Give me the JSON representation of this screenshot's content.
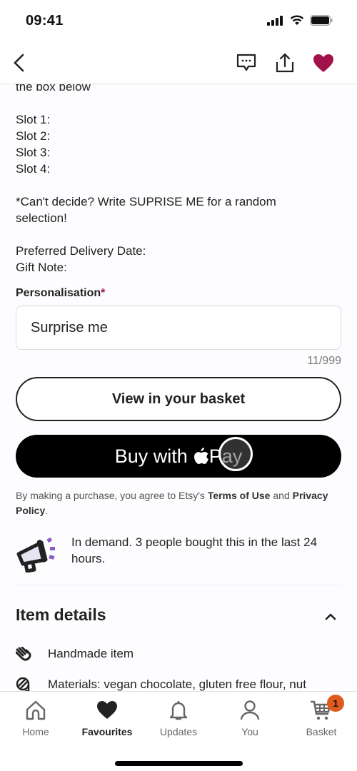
{
  "status_bar": {
    "time": "09:41"
  },
  "header": {
    "back_icon": "chevron-left-icon",
    "actions": [
      {
        "name": "message-icon"
      },
      {
        "name": "share-icon"
      },
      {
        "name": "favourite-heart-icon",
        "color": "#a1124a"
      }
    ]
  },
  "description": {
    "lines": [
      "the box below",
      "",
      "Slot 1:",
      "Slot 2:",
      "Slot 3:",
      "Slot 4:",
      "",
      "*Can't decide? Write SUPRISE ME for a random selection!",
      "",
      "Preferred Delivery Date:",
      "Gift Note:"
    ]
  },
  "personalisation": {
    "label": "Personalisation",
    "required_mark": "*",
    "value": "Surprise me",
    "counter": "11/999"
  },
  "buttons": {
    "view_basket": "View in your basket",
    "apple_pay_prefix": "Buy with",
    "apple_glyph": "",
    "apple_pay_suffix": "Pay"
  },
  "legal": {
    "text_before": "By making a purchase, you agree to Etsy's ",
    "terms_link": "Terms of Use",
    "text_mid": " and ",
    "privacy_link": "Privacy Policy",
    "text_after": "."
  },
  "demand": {
    "text": "In demand. 3 people bought this in the last 24 hours.",
    "icon": "megaphone-icon"
  },
  "item_details": {
    "title": "Item details",
    "rows": [
      {
        "icon": "hand-icon",
        "text": "Handmade item"
      },
      {
        "icon": "materials-icon",
        "text": "Materials: vegan chocolate, gluten free flour, nut"
      }
    ]
  },
  "tab_bar": {
    "tabs": [
      {
        "label": "Home",
        "icon": "home-icon",
        "active": false
      },
      {
        "label": "Favourites",
        "icon": "heart-icon",
        "active": true
      },
      {
        "label": "Updates",
        "icon": "bell-icon",
        "active": false
      },
      {
        "label": "You",
        "icon": "person-icon",
        "active": false
      },
      {
        "label": "Basket",
        "icon": "cart-icon",
        "active": false,
        "badge": "1"
      }
    ],
    "badge_color": "#e05a1e"
  }
}
